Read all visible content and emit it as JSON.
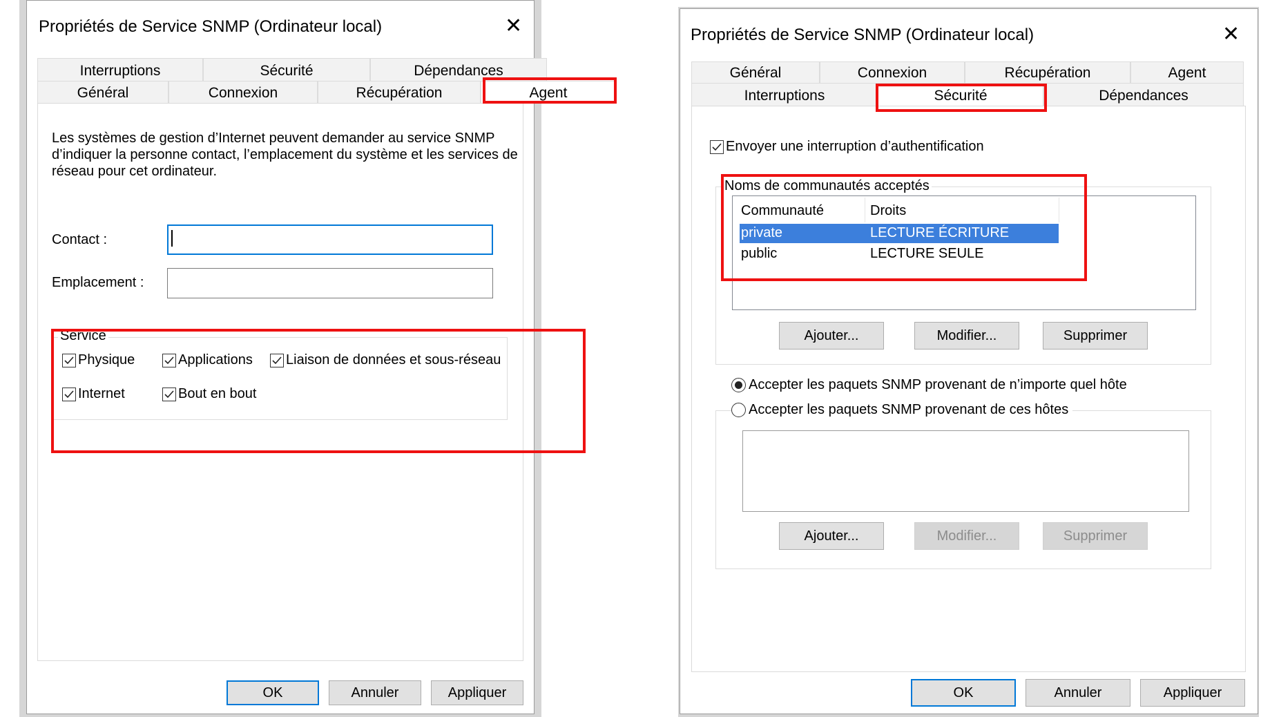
{
  "dialog_left": {
    "title": "Propriétés de Service SNMP (Ordinateur local)",
    "tabs_back": [
      "Interruptions",
      "Sécurité",
      "Dépendances"
    ],
    "tabs_front": [
      "Général",
      "Connexion",
      "Récupération",
      "Agent"
    ],
    "selected_tab": "Agent",
    "description": [
      "Les systèmes de gestion d’Internet peuvent demander au service SNMP",
      "d’indiquer la personne contact, l’emplacement du système et les services de",
      "réseau pour cet ordinateur."
    ],
    "contact_label": "Contact :",
    "contact_value": "",
    "location_label": "Emplacement :",
    "location_value": "",
    "service_group": "Service",
    "services": [
      {
        "label": "Physique",
        "checked": true
      },
      {
        "label": "Applications",
        "checked": true
      },
      {
        "label": "Liaison de données et sous-réseau",
        "checked": true
      },
      {
        "label": "Internet",
        "checked": true
      },
      {
        "label": "Bout en bout",
        "checked": true
      }
    ],
    "buttons": {
      "ok": "OK",
      "cancel": "Annuler",
      "apply": "Appliquer"
    }
  },
  "dialog_right": {
    "title": "Propriétés de Service SNMP (Ordinateur local)",
    "tabs_back": [
      "Général",
      "Connexion",
      "Récupération",
      "Agent"
    ],
    "tabs_front": [
      "Interruptions",
      "Sécurité",
      "Dépendances"
    ],
    "selected_tab": "Sécurité",
    "send_auth_trap": {
      "label": "Envoyer une interruption d’authentification",
      "checked": true
    },
    "communities_group": "Noms de communautés acceptés",
    "columns": [
      "Communauté",
      "Droits"
    ],
    "communities": [
      {
        "name": "private",
        "rights": "LECTURE ÉCRITURE",
        "selected": true
      },
      {
        "name": "public",
        "rights": "LECTURE SEULE",
        "selected": false
      }
    ],
    "community_buttons": {
      "add": "Ajouter...",
      "edit": "Modifier...",
      "remove": "Supprimer"
    },
    "radio_any_host": {
      "label": "Accepter les paquets SNMP provenant de n’importe quel hôte",
      "selected": true
    },
    "radio_these_hosts": {
      "label": "Accepter les paquets SNMP provenant de ces hôtes",
      "selected": false
    },
    "hosts": [],
    "host_buttons": {
      "add": "Ajouter...",
      "edit": "Modifier...",
      "remove": "Supprimer"
    },
    "buttons": {
      "ok": "OK",
      "cancel": "Annuler",
      "apply": "Appliquer"
    }
  },
  "colors": {
    "highlight_red": "#ee1111",
    "selection_blue": "#3c7fdc",
    "focus_blue": "#0078d7"
  }
}
